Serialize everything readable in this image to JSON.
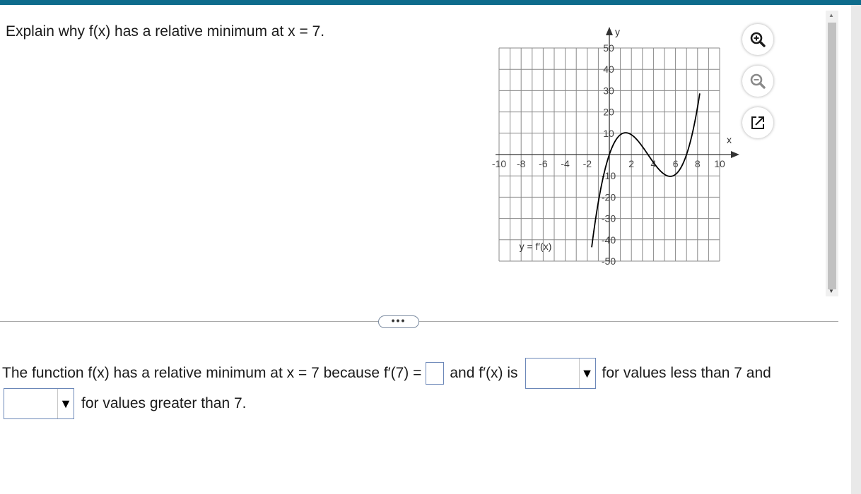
{
  "question": "Explain why f(x) has a relative minimum at x = 7.",
  "graph": {
    "x_label": "x",
    "y_label": "y",
    "curve_label": "y = f′(x)",
    "x_ticks": [
      "-10",
      "-8",
      "-6",
      "-4",
      "-2",
      "2",
      "4",
      "6",
      "8",
      "10"
    ],
    "y_ticks_pos": [
      "50",
      "40",
      "30",
      "20",
      "10"
    ],
    "y_ticks_neg": [
      "-10",
      "-20",
      "-30",
      "-40",
      "-50"
    ],
    "curve_color": "#000000",
    "grid_color": "#8a8a8a"
  },
  "tools": {
    "zoom_in_icon": "zoom-in-icon",
    "zoom_out_icon": "zoom-out-icon",
    "popout_icon": "external-window-icon"
  },
  "more_button": "•••",
  "answer": {
    "text1": "The function f(x) has a relative minimum at x = 7 because f′(7) =",
    "text2": "and f′(x) is",
    "text3": "for values less than 7 and",
    "text4": "for values greater than 7.",
    "select1_value": "",
    "select2_value": "",
    "blank_value": ""
  },
  "colors": {
    "top_bar": "#0e6c8c",
    "input_border": "#6b87b8"
  }
}
